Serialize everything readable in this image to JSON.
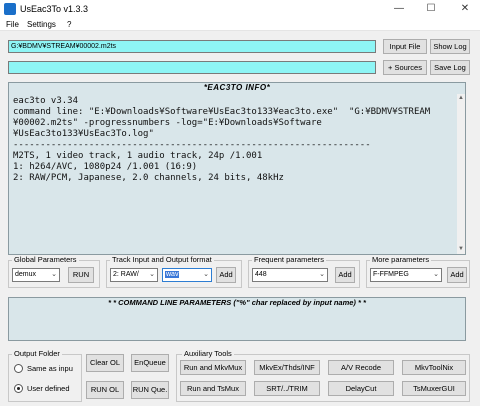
{
  "window": {
    "title": "UsEac3To v1.3.3",
    "minimize": "—",
    "maximize": "☐",
    "close": "✕"
  },
  "menu": {
    "file": "File",
    "settings": "Settings",
    "help": "?"
  },
  "input_path": "G:¥BDMV¥STREAM¥00002.m2ts",
  "output_path": "",
  "buttons": {
    "input_file": "Input File",
    "show_log": "Show Log",
    "sources": "+ Sources",
    "save_log": "Save Log",
    "run": "RUN",
    "add_track": "Add",
    "add_freq": "Add",
    "add_more": "Add",
    "clear_ol": "Clear OL",
    "enqueue": "EnQueue",
    "run_ol": "RUN OL",
    "run_queue": "RUN Que.",
    "run_mkvmux": "Run and MkvMux",
    "mkvex": "MkvEx/Thds/INF",
    "av_recode": "A/V Recode",
    "mkvtoolnix": "MkvToolNix",
    "run_tsmux": "Run and TsMux",
    "srt_trim": "SRT/../TRIM",
    "delaycut": "DelayCut",
    "tsmuxergui": "TsMuxerGUI"
  },
  "info": {
    "header": "*EAC3TO INFO*",
    "lines": "eac3to v3.34\ncommand line: \"E:¥Downloads¥Software¥UsEac3to133¥eac3to.exe\"  \"G:¥BDMV¥STREAM\n¥00002.m2ts\" -progressnumbers -log=\"E:¥Downloads¥Software\n¥UsEac3to133¥UsEac3To.log\"\n------------------------------------------------------------------\nM2TS, 1 video track, 1 audio track, 24p /1.001\n1: h264/AVC, 1080p24 /1.001 (16:9)\n2: RAW/PCM, Japanese, 2.0 channels, 24 bits, 48kHz"
  },
  "global_params": {
    "label": "Global Parameters",
    "value": "demux"
  },
  "track": {
    "label": "Track Input and Output format",
    "track_value": "2: RAW/",
    "format_value": "wav"
  },
  "frequent": {
    "label": "Frequent parameters",
    "value": "448"
  },
  "more": {
    "label": "More parameters",
    "value": "F-FFMPEG"
  },
  "cmd": {
    "header": "* * COMMAND LINE PARAMETERS (\"%\" char replaced by input name) * *",
    "value": ""
  },
  "output_folder": {
    "label": "Output Folder",
    "same_as_input": "Same as inpu",
    "user_defined": "User defined"
  },
  "aux_tools": {
    "label": "Auxiliary Tools"
  },
  "colors": {
    "cyan_field": "#8ef5f5",
    "info_bg": "#d9e6ea"
  }
}
